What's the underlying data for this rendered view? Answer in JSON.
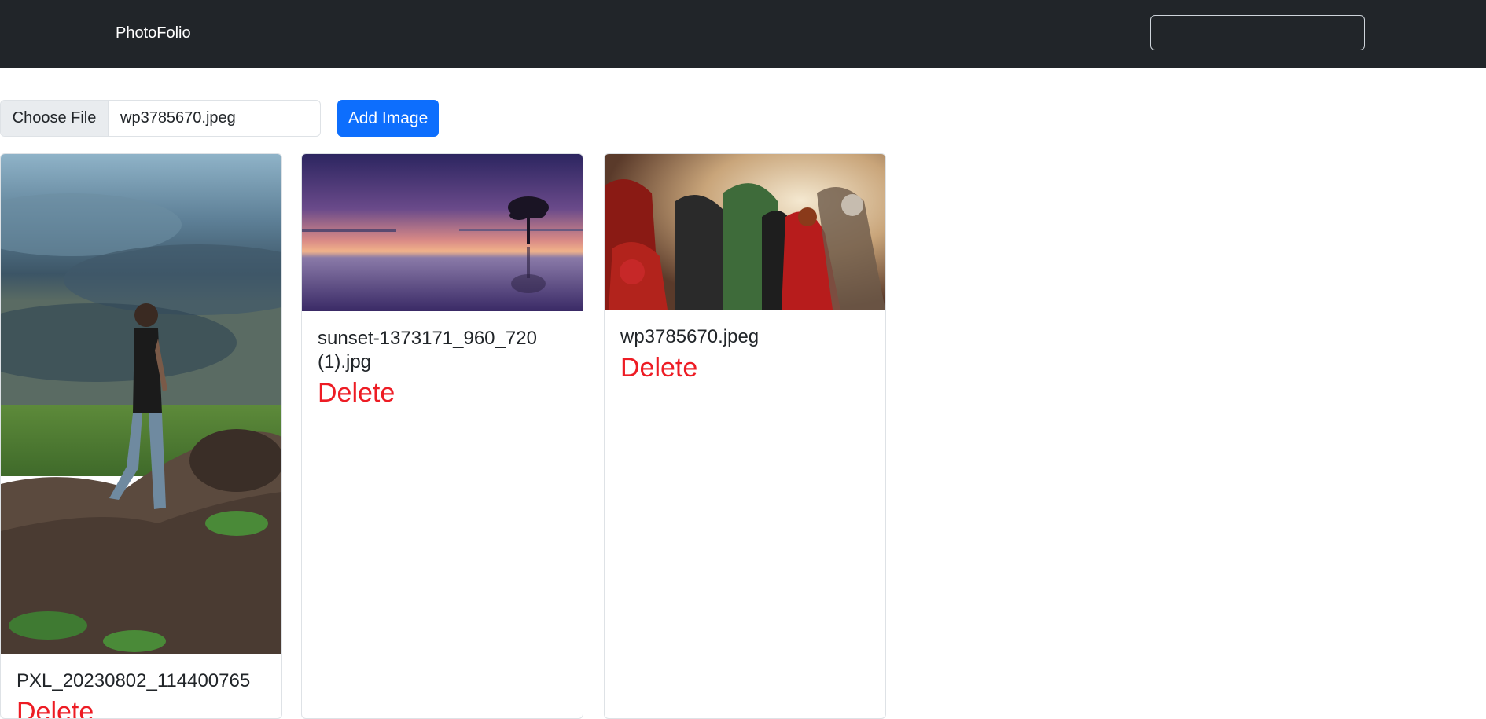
{
  "navbar": {
    "brand": "PhotoFolio",
    "search_value": ""
  },
  "upload": {
    "choose_file_label": "Choose File",
    "file_name": "wp3785670.jpeg",
    "add_button_label": "Add Image"
  },
  "cards": [
    {
      "title": "PXL_20230802_114400765",
      "delete_label": "Delete"
    },
    {
      "title": "sunset-1373171_960_720 (1).jpg",
      "delete_label": "Delete"
    },
    {
      "title": "wp3785670.jpeg",
      "delete_label": "Delete"
    }
  ],
  "colors": {
    "navbar_bg": "#212529",
    "primary": "#0d6efd",
    "delete": "#ed1c24"
  }
}
